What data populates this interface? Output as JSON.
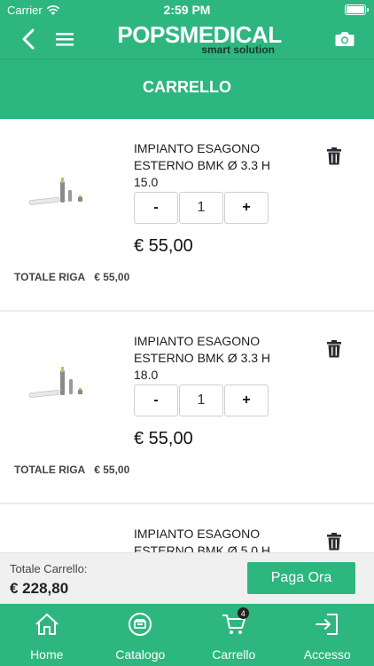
{
  "status_bar": {
    "carrier": "Carrier",
    "time": "2:59 PM"
  },
  "header": {
    "brand_name": "POPSMEDICAL",
    "brand_tagline": "smart solution",
    "title": "CARRELLO",
    "icons": [
      "back-icon",
      "menu-icon",
      "camera-icon"
    ]
  },
  "cart": {
    "items": [
      {
        "name": "IMPIANTO ESAGONO ESTERNO BMK Ø 3.3 H 15.0",
        "quantity": "1",
        "minus": "-",
        "plus": "+",
        "price": "€ 55,00",
        "row_total_label": "TOTALE RIGA",
        "row_total_value": "€ 55,00"
      },
      {
        "name": "IMPIANTO ESAGONO ESTERNO BMK Ø 3.3 H 18.0",
        "quantity": "1",
        "minus": "-",
        "plus": "+",
        "price": "€ 55,00",
        "row_total_label": "TOTALE RIGA",
        "row_total_value": "€ 55,00"
      },
      {
        "name": "IMPIANTO ESAGONO ESTERNO BMK Ø 5.0 H",
        "quantity": "",
        "minus": "",
        "plus": "",
        "price": "",
        "row_total_label": "",
        "row_total_value": ""
      }
    ]
  },
  "summary": {
    "label": "Totale Carrello:",
    "total": "€ 228,80",
    "pay_button": "Paga Ora"
  },
  "tabbar": {
    "tabs": [
      {
        "label": "Home",
        "icon": "home-icon"
      },
      {
        "label": "Catalogo",
        "icon": "catalog-icon"
      },
      {
        "label": "Carrello",
        "icon": "cart-icon",
        "badge": "4"
      },
      {
        "label": "Accesso",
        "icon": "login-icon"
      }
    ]
  },
  "colors": {
    "accent": "#2eb67f",
    "background": "#ffffff",
    "summary_bg": "#f0f0f0",
    "text": "#111111"
  }
}
